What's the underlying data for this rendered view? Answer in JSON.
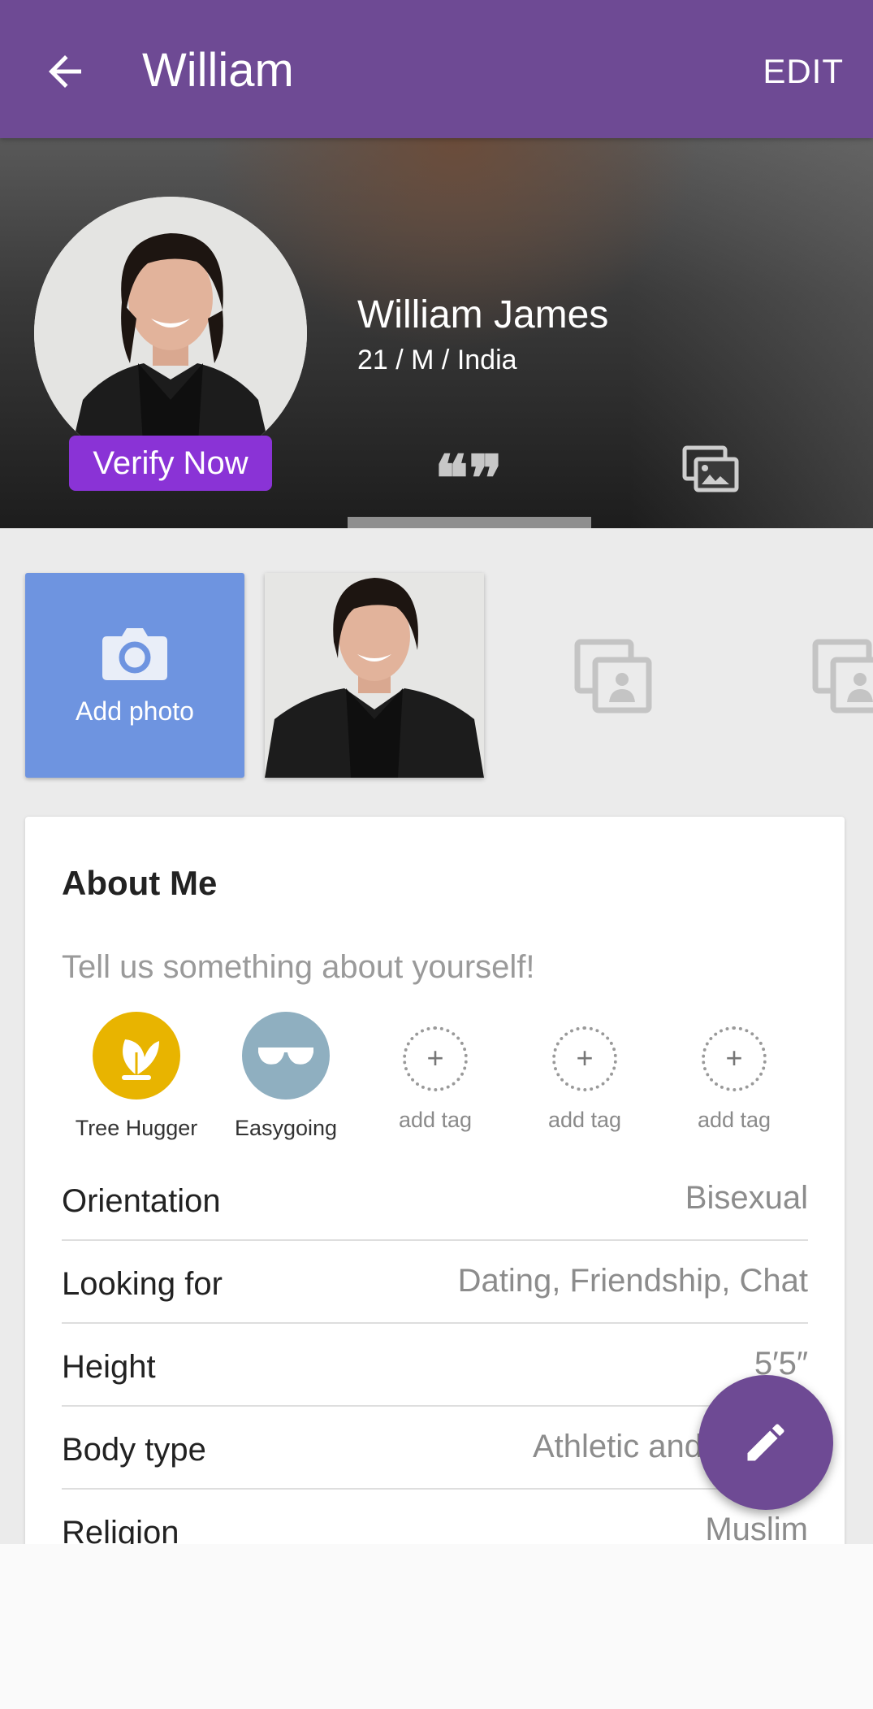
{
  "appbar": {
    "title": "William",
    "edit_label": "EDIT"
  },
  "profile": {
    "full_name": "William James",
    "meta": "21 / M / India",
    "verify_label": "Verify Now"
  },
  "photos": {
    "add_label": "Add photo"
  },
  "about": {
    "heading": "About Me",
    "placeholder": "Tell us something about yourself!",
    "tags": [
      {
        "label": "Tree Hugger",
        "color": "#e8b400",
        "icon": "tree-hugger-icon"
      },
      {
        "label": "Easygoing",
        "color": "#8fafc0",
        "icon": "sunglasses-icon"
      },
      {
        "label": "add tag",
        "icon": "add-tag-icon"
      },
      {
        "label": "add tag",
        "icon": "add-tag-icon"
      },
      {
        "label": "add tag",
        "icon": "add-tag-icon"
      }
    ],
    "details": [
      {
        "label": "Orientation",
        "value": "Bisexual"
      },
      {
        "label": "Looking for",
        "value": "Dating, Friendship, Chat"
      },
      {
        "label": "Height",
        "value": "5′5″"
      },
      {
        "label": "Body type",
        "value": "Athletic and"
      },
      {
        "label": "Religion",
        "value": "Muslim"
      }
    ]
  },
  "colors": {
    "brand_purple": "#6e4a94",
    "verify_purple": "#8a33d6",
    "add_photo_blue": "#6e94e0"
  }
}
